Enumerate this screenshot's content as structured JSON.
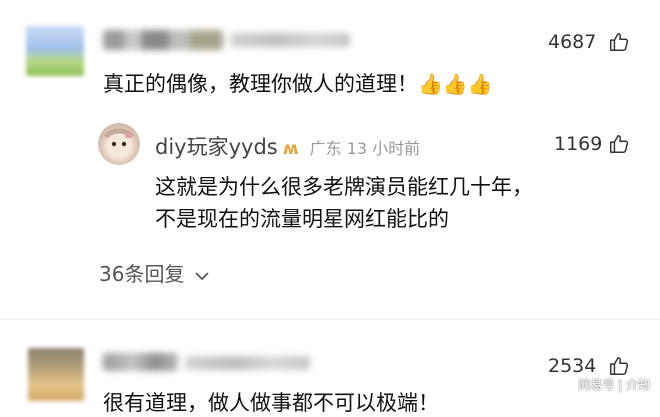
{
  "comments": [
    {
      "like_count": "4687",
      "text": "真正的偶像，教理你做人的道理！",
      "emoji": "👍👍👍",
      "reply": {
        "name": "diy玩家yyds",
        "badge": "ʍ",
        "location_time": "广东 13 小时前",
        "like_count": "1169",
        "text_line1": "这就是为什么很多老牌演员能红几十年，",
        "text_line2": "不是现在的流量明星网红能比的"
      },
      "more_replies": "36条回复"
    },
    {
      "like_count": "2534",
      "text": "很有道理，做人做事都不可以极端！"
    }
  ],
  "watermark": "网易号 | 介知",
  "colors": {
    "badge": "#e8a33a",
    "meta": "#9a9a9a"
  }
}
